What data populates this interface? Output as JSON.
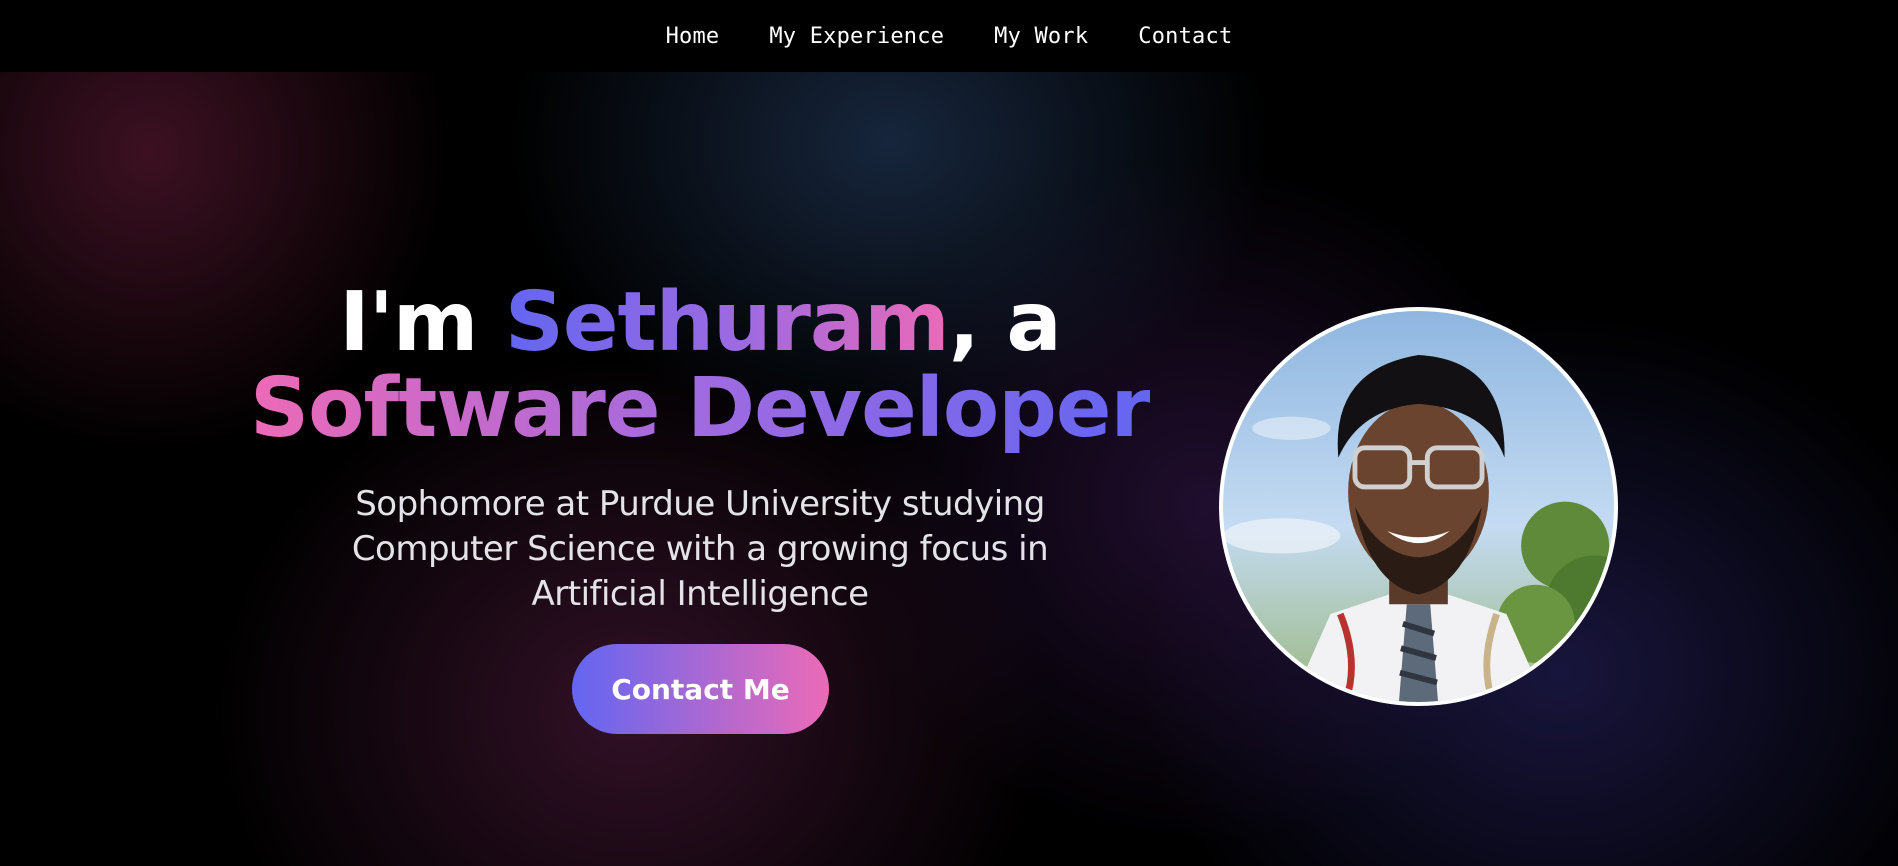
{
  "nav": {
    "items": [
      {
        "label": "Home"
      },
      {
        "label": "My Experience"
      },
      {
        "label": "My Work"
      },
      {
        "label": "Contact"
      }
    ]
  },
  "hero": {
    "headline_prefix": "I'm ",
    "headline_name": "Sethuram",
    "headline_suffix": ", a",
    "headline_role": "Software Developer",
    "subtitle": "Sophomore at Purdue University studying Computer Science with a growing focus in Artificial Intelligence",
    "cta_label": "Contact Me"
  },
  "colors": {
    "accent_indigo": "#6366f1",
    "accent_pink": "#ec6ab6",
    "background": "#000000"
  }
}
